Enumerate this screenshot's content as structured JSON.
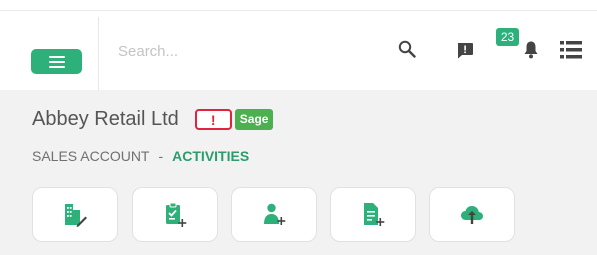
{
  "header": {
    "search_placeholder": "Search...",
    "notification_count": "23",
    "icons": [
      "menu-icon",
      "search-icon",
      "chat-icon",
      "bell-icon",
      "list-icon"
    ]
  },
  "account": {
    "company_name": "Abbey Retail Ltd",
    "alert_label": "!",
    "source_badge": "Sage"
  },
  "breadcrumb": {
    "section": "SALES ACCOUNT",
    "separator": "-",
    "current": "ACTIVITIES"
  },
  "actions": [
    {
      "icon": "edit-company-icon"
    },
    {
      "icon": "add-task-icon"
    },
    {
      "icon": "add-contact-icon"
    },
    {
      "icon": "add-document-icon"
    },
    {
      "icon": "cloud-upload-icon"
    }
  ],
  "colors": {
    "accent": "#2db07a",
    "accent_text": "#2a9d6a",
    "alert": "#e0243e",
    "sage": "#4caf50",
    "panel_bg": "#f2f2f2",
    "icon_dark": "#444444"
  }
}
